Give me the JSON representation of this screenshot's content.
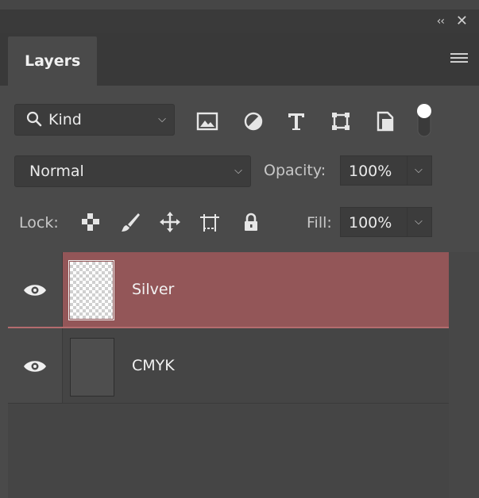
{
  "window": {
    "collapse_icon": "double-chevron-left-icon",
    "close_icon": "close-icon"
  },
  "tabs": [
    {
      "label": "Layers"
    }
  ],
  "filter": {
    "kind_label": "Kind"
  },
  "blend": {
    "mode": "Normal"
  },
  "opacity": {
    "label": "Opacity:",
    "value": "100%"
  },
  "lock": {
    "label": "Lock:"
  },
  "fill": {
    "label": "Fill:",
    "value": "100%"
  },
  "layers": [
    {
      "name": "Silver",
      "selected": true,
      "visible": true
    },
    {
      "name": "CMYK",
      "selected": false,
      "visible": true
    }
  ],
  "colors": {
    "selected_row": "#935658",
    "panel": "#4a4a4a"
  }
}
